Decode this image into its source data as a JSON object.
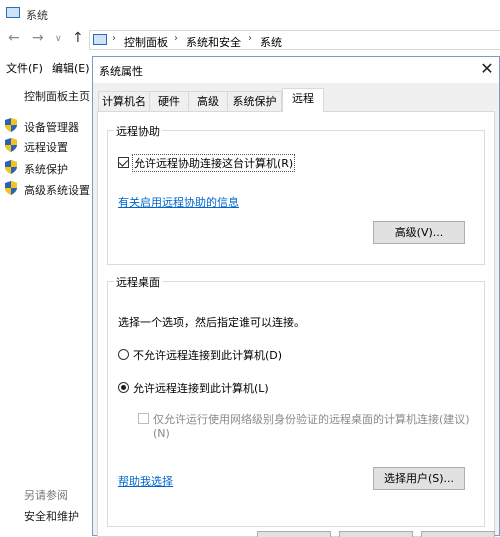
{
  "window": {
    "title": "系统",
    "breadcrumb": [
      "控制面板",
      "系统和安全",
      "系统"
    ]
  },
  "menu": {
    "file": "文件(F)",
    "edit": "编辑(E)"
  },
  "left_pane": {
    "home": "控制面板主页",
    "items": [
      "设备管理器",
      "远程设置",
      "系统保护",
      "高级系统设置"
    ],
    "see_also_title": "另请参阅",
    "see_also_items": [
      "安全和维护"
    ]
  },
  "dialog": {
    "title": "系统属性",
    "tabs": [
      "计算机名",
      "硬件",
      "高级",
      "系统保护",
      "远程"
    ],
    "active_tab": 4,
    "remote_assistance": {
      "title": "远程协助",
      "allow_label": "允许远程协助连接这台计算机(R)",
      "allow_checked": true,
      "info_link": "有关启用远程协助的信息",
      "advanced_button": "高级(V)..."
    },
    "remote_desktop": {
      "title": "远程桌面",
      "instruction": "选择一个选项，然后指定谁可以连接。",
      "option_deny": "不允许远程连接到此计算机(D)",
      "option_allow": "允许远程连接到此计算机(L)",
      "selected": "allow",
      "nla_label_line1": "仅允许运行使用网络级别身份验证的远程桌面的计算机连接(建议)",
      "nla_label_line2": "(N)",
      "nla_checked": false,
      "help_link": "帮助我选择",
      "select_users_button": "选择用户(S)..."
    }
  },
  "colors": {
    "link": "#0066cc",
    "dialog_bg": "#f0f0f0",
    "dialog_border": "#7a9cc7"
  }
}
